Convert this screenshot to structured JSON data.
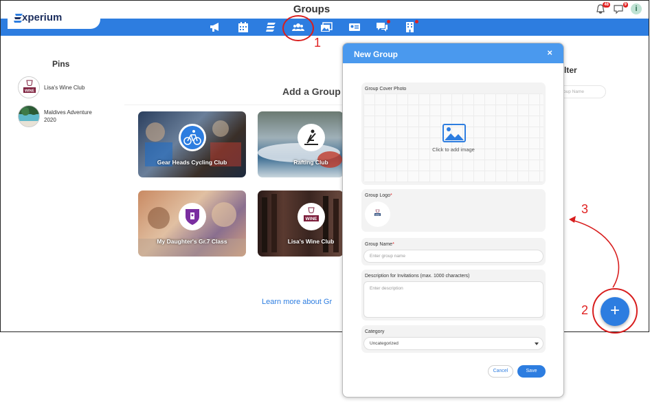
{
  "app": {
    "title": "Groups",
    "brand": "xperium"
  },
  "topbar": {
    "icons": [
      {
        "name": "bell-icon",
        "badge": "48"
      },
      {
        "name": "chat-icon",
        "badge": "9"
      },
      {
        "name": "info-icon",
        "glyph": "i"
      }
    ]
  },
  "nav": {
    "items": [
      {
        "name": "megaphone-icon"
      },
      {
        "name": "calendar-icon"
      },
      {
        "name": "stack-icon"
      },
      {
        "name": "groups-icon",
        "active": true
      },
      {
        "name": "photos-icon"
      },
      {
        "name": "id-card-icon"
      },
      {
        "name": "messages-icon",
        "dot": true
      },
      {
        "name": "building-icon",
        "dot": true
      }
    ]
  },
  "pins": {
    "title": "Pins",
    "items": [
      {
        "label": "Lisa's Wine Club",
        "avatar_text": "WINE"
      },
      {
        "label": "Maldives Adventure 2020"
      }
    ]
  },
  "add_group": {
    "title": "Add a Group",
    "cards": [
      {
        "label": "Gear Heads Cycling Club",
        "icon": "bicycle-icon"
      },
      {
        "label": "Rafting Club",
        "icon": "rafting-icon"
      },
      {
        "label": "My Daughter's Gr.7 Class",
        "icon": "school-crest-icon"
      },
      {
        "label": "Lisa's Wine Club",
        "icon": "wine-icon",
        "icon_text": "WINE"
      }
    ]
  },
  "learn_more": "Learn more about Gr",
  "filter": {
    "title": "lter",
    "placeholder": "oup Name"
  },
  "fab": {
    "label": "+"
  },
  "modal": {
    "title": "New Group",
    "close": "×",
    "cover": {
      "label": "Group Cover Photo",
      "hint": "Click to add image"
    },
    "logo": {
      "label": "Group Logo",
      "required": "*",
      "thumb_text": "WINE"
    },
    "name": {
      "label": "Group Name",
      "required": "*",
      "placeholder": "Enter group name"
    },
    "description": {
      "label": "Description for Invitations (max. 1000 characters)",
      "placeholder": "Enter description"
    },
    "category": {
      "label": "Category",
      "value": "Uncategorized"
    },
    "cancel_label": "Cancel",
    "save_label": "Save"
  },
  "annotations": {
    "one": "1",
    "two": "2",
    "three": "3"
  },
  "colors": {
    "brand_blue": "#2d7de0",
    "header_blue": "#4a99ee",
    "annotation_red": "#e02020"
  }
}
